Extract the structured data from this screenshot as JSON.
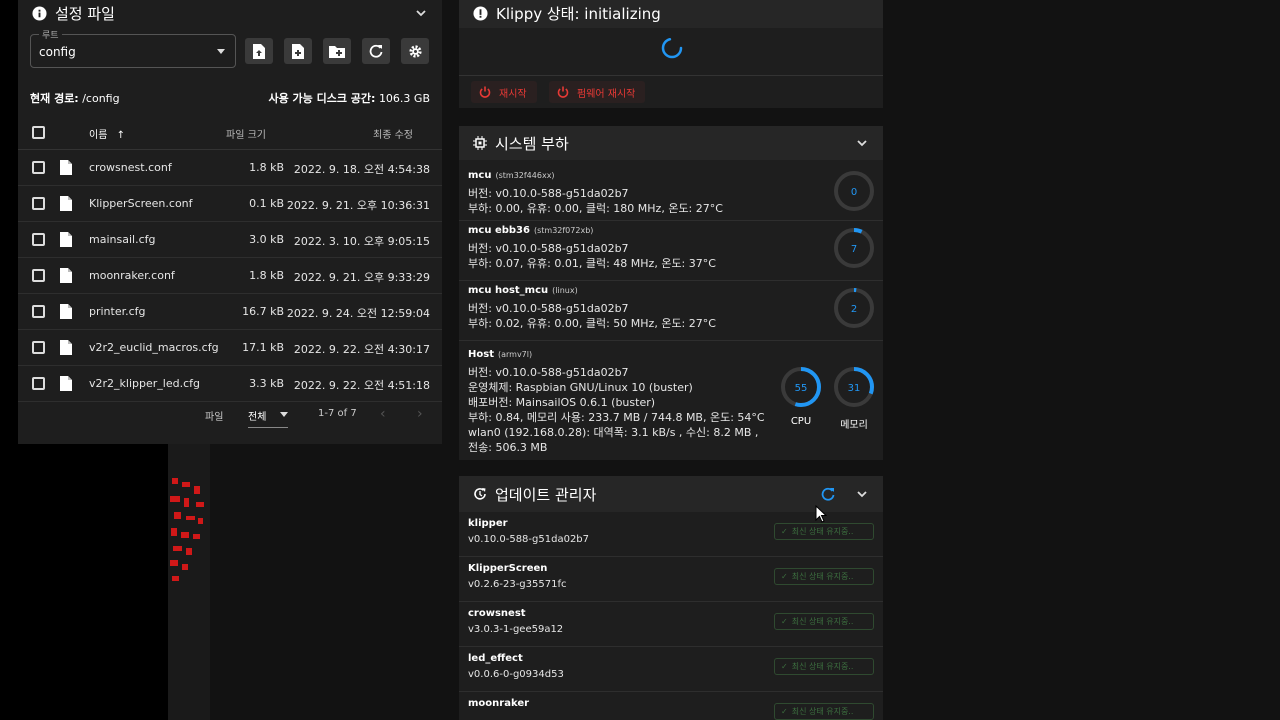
{
  "config_files": {
    "title": "설정 파일",
    "root_label": "루트",
    "root_value": "config",
    "current_path_label": "현재 경로:",
    "current_path": "/config",
    "disk_label": "사용 가능 디스크 공간:",
    "disk_value": "106.3 GB",
    "columns": {
      "name": "이름",
      "size": "파일 크기",
      "modified": "최종 수정"
    },
    "files": [
      {
        "name": "crowsnest.conf",
        "size": "1.8 kB",
        "date": "2022. 9. 18. 오전 4:54:38"
      },
      {
        "name": "KlipperScreen.conf",
        "size": "0.1 kB",
        "date": "2022. 9. 21. 오후 10:36:31"
      },
      {
        "name": "mainsail.cfg",
        "size": "3.0 kB",
        "date": "2022. 3. 10. 오후 9:05:15"
      },
      {
        "name": "moonraker.conf",
        "size": "1.8 kB",
        "date": "2022. 9. 21. 오후 9:33:29"
      },
      {
        "name": "printer.cfg",
        "size": "16.7 kB",
        "date": "2022. 9. 24. 오전 12:59:04"
      },
      {
        "name": "v2r2_euclid_macros.cfg",
        "size": "17.1 kB",
        "date": "2022. 9. 22. 오전 4:30:17"
      },
      {
        "name": "v2r2_klipper_led.cfg",
        "size": "3.3 kB",
        "date": "2022. 9. 22. 오전 4:51:18"
      }
    ],
    "pager": {
      "per_page_label": "파일",
      "per_page_value": "전체",
      "range": "1-7 of 7"
    }
  },
  "klippy": {
    "title": "Klippy 상태: initializing",
    "restart_label": "재시작",
    "firmware_restart_label": "펌웨어 재시작"
  },
  "system_load": {
    "title": "시스템 부하",
    "mcus": [
      {
        "name": "mcu",
        "chip": "(stm32f446xx)",
        "version": "버전: v0.10.0-588-g51da02b7",
        "load": "부하: 0.00, 유휴: 0.00, 클럭: 180 MHz, 온도: 27°C",
        "gauge": "0",
        "gauge_pct": 0
      },
      {
        "name": "mcu ebb36",
        "chip": "(stm32f072xb)",
        "version": "버전: v0.10.0-588-g51da02b7",
        "load": "부하: 0.07, 유휴: 0.01, 클럭: 48 MHz, 온도: 37°C",
        "gauge": "7",
        "gauge_pct": 7
      },
      {
        "name": "mcu host_mcu",
        "chip": "(linux)",
        "version": "버전: v0.10.0-588-g51da02b7",
        "load": "부하: 0.02, 유휴: 0.00, 클럭: 50 MHz, 온도: 27°C",
        "gauge": "2",
        "gauge_pct": 2
      }
    ],
    "host": {
      "name": "Host",
      "chip": "(armv7l)",
      "lines": [
        "버전: v0.10.0-588-g51da02b7",
        "운영체제: Raspbian GNU/Linux 10 (buster)",
        "배포버전: MainsailOS 0.6.1 (buster)",
        "부하: 0.84, 메모리 사용: 233.7 MB / 744.8 MB, 온도: 54°C",
        "wlan0 (192.168.0.28): 대역폭: 3.1 kB/s , 수신: 8.2 MB ,",
        "전송: 506.3 MB"
      ],
      "cpu_value": "55",
      "cpu_pct": 55,
      "cpu_label": "CPU",
      "mem_value": "31",
      "mem_pct": 31,
      "mem_label": "메모리"
    }
  },
  "update_manager": {
    "title": "업데이트 관리자",
    "items": [
      {
        "name": "klipper",
        "version": "v0.10.0-588-g51da02b7",
        "status": "최신 상태 유지중.."
      },
      {
        "name": "KlipperScreen",
        "version": "v0.2.6-23-g35571fc",
        "status": "최신 상태 유지중.."
      },
      {
        "name": "crowsnest",
        "version": "v3.0.3-1-gee59a12",
        "status": "최신 상태 유지중.."
      },
      {
        "name": "led_effect",
        "version": "v0.0.6-0-g0934d53",
        "status": "최신 상태 유지중.."
      },
      {
        "name": "moonraker",
        "version": "",
        "status": "최신 상태 유지중.."
      }
    ]
  },
  "colors": {
    "accent": "#2196f3",
    "danger": "#e53935",
    "success": "#3c6e3f",
    "panel": "#1e1e1e"
  }
}
